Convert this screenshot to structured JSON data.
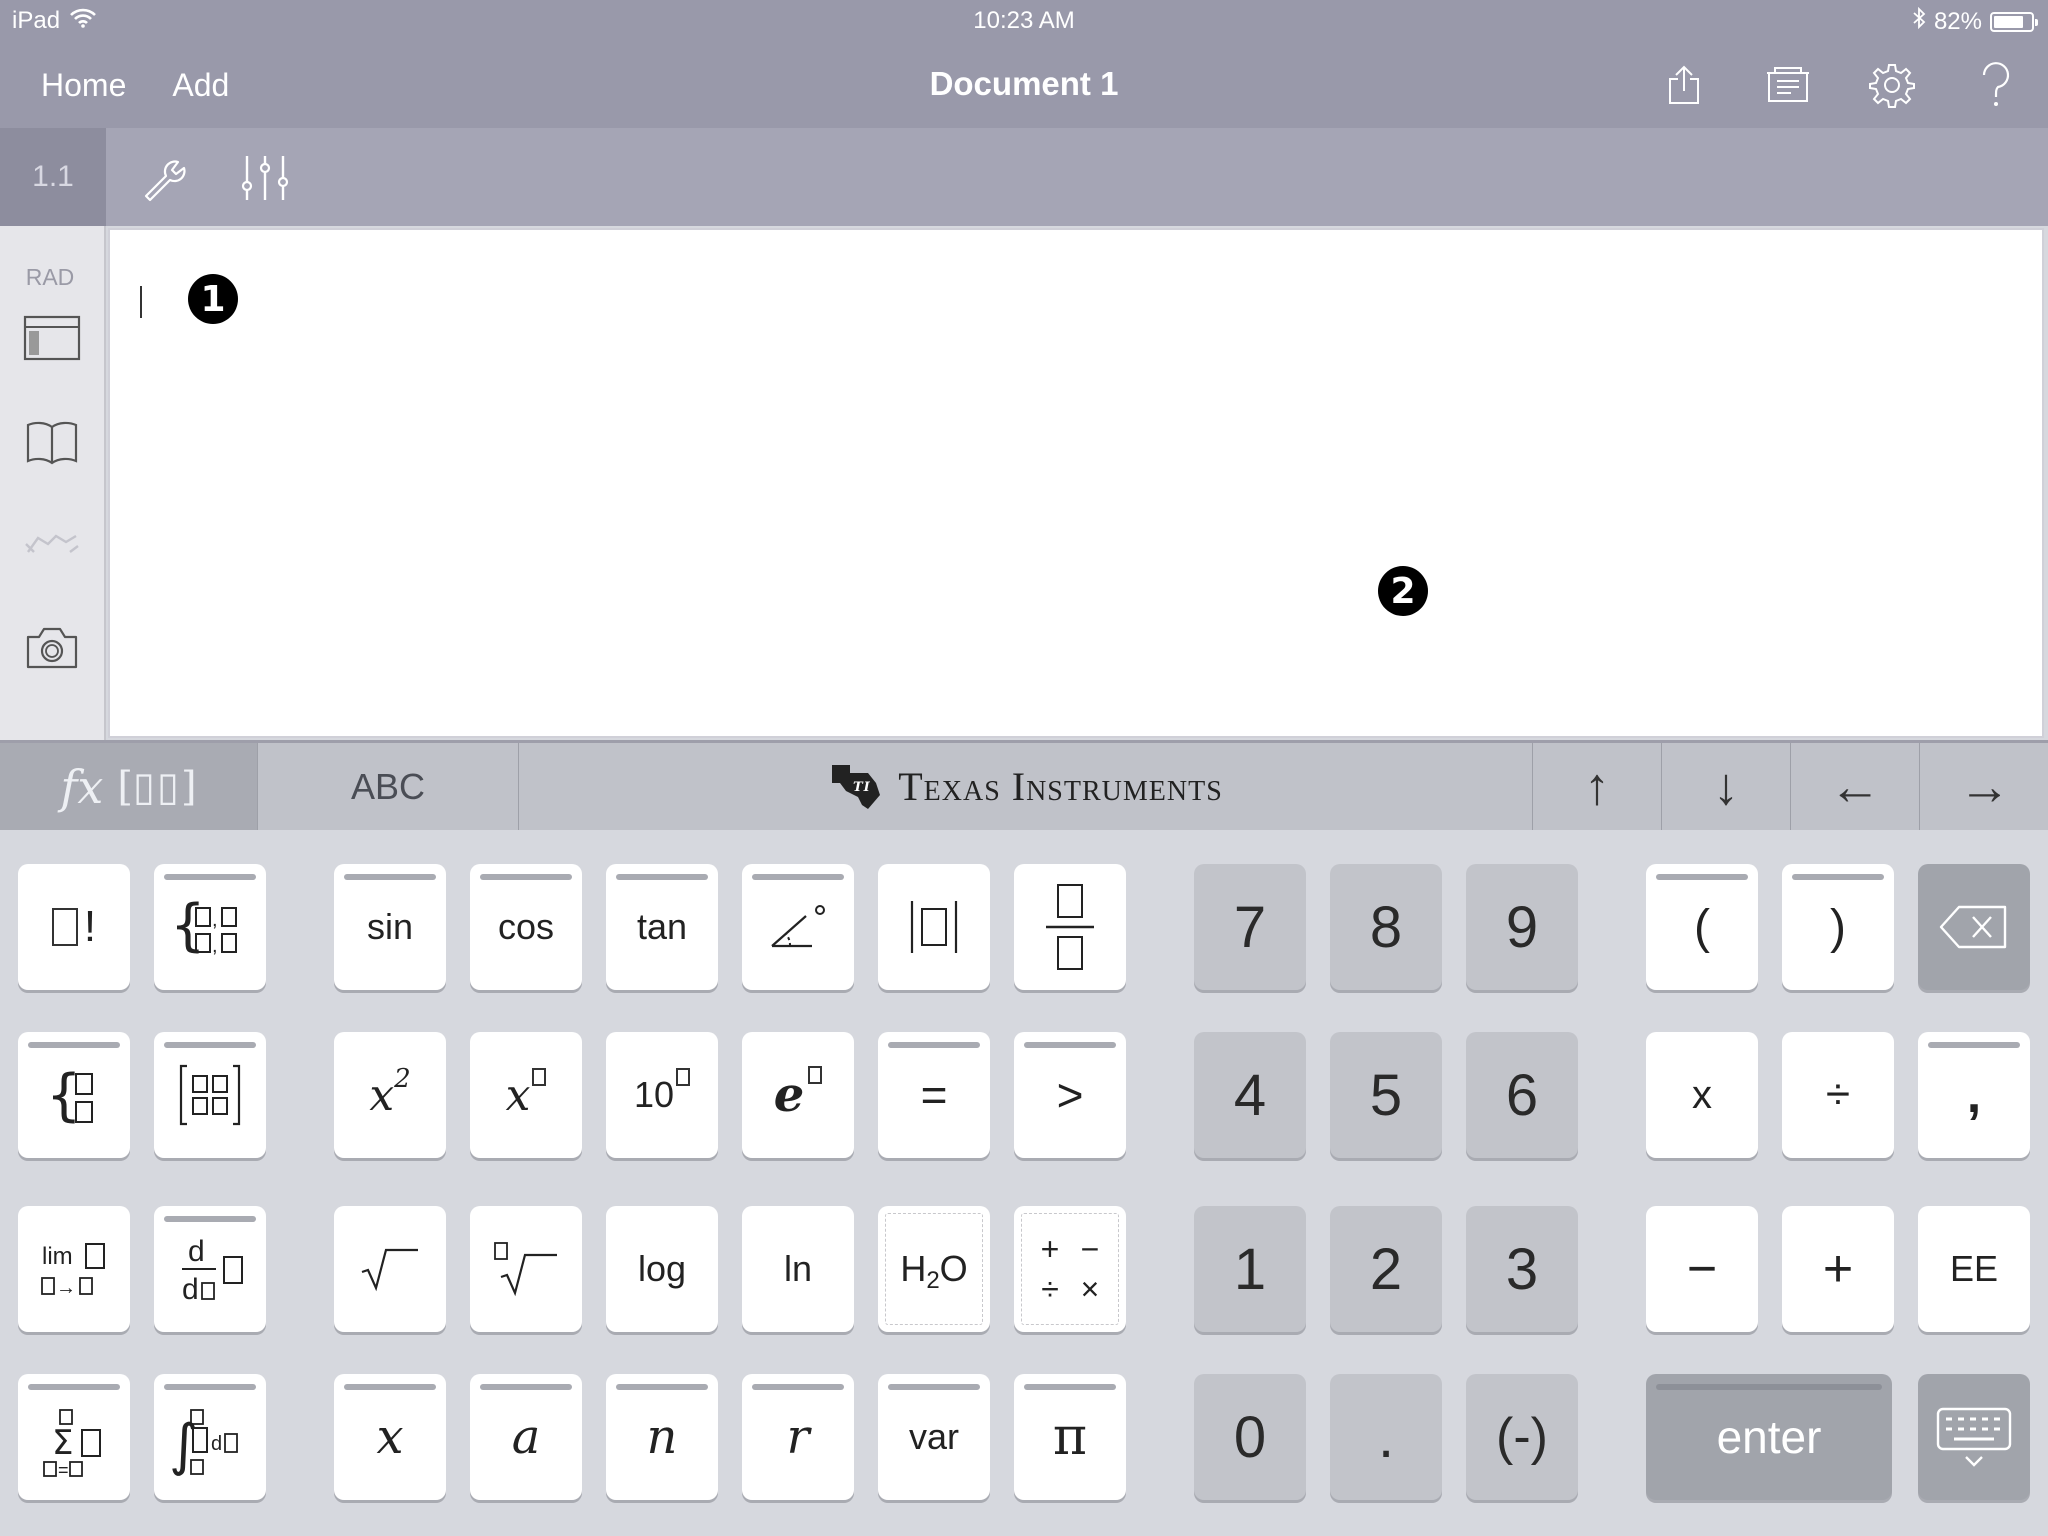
{
  "status": {
    "device": "iPad",
    "time": "10:23 AM",
    "battery": "82%",
    "battery_level": 0.82
  },
  "nav": {
    "home": "Home",
    "add": "Add",
    "title": "Document 1"
  },
  "toolbar": {
    "page": "1.1"
  },
  "sidebar": {
    "mode": "RAD"
  },
  "markers": {
    "one": "1",
    "two": "2"
  },
  "kbd_strip": {
    "fx": "fx",
    "abc": "ABC",
    "brand": "Texas Instruments",
    "up": "↑",
    "down": "↓",
    "left": "←",
    "right": "→"
  },
  "keys": {
    "sin": "sin",
    "cos": "cos",
    "tan": "tan",
    "n7": "7",
    "n8": "8",
    "n9": "9",
    "lparen": "(",
    "rparen": ")",
    "x2_base": "x",
    "x2_exp": "2",
    "xbox_base": "x",
    "ten": "10",
    "e": "e",
    "eq": "=",
    "gt": ">",
    "n4": "4",
    "n5": "5",
    "n6": "6",
    "times": "x",
    "divide": "÷",
    "comma": ",",
    "lim": "lim",
    "arrow": "→",
    "d": "d",
    "log": "log",
    "ln": "ln",
    "h2o_h": "H",
    "h2o_2": "2",
    "h2o_o": "O",
    "ops_plus": "+",
    "ops_minus": "−",
    "ops_div": "÷",
    "ops_times": "×",
    "n1": "1",
    "n2": "2",
    "n3": "3",
    "minus": "−",
    "plus": "+",
    "ee": "EE",
    "var_x": "x",
    "var_a": "a",
    "var_n": "n",
    "var_r": "r",
    "var": "var",
    "pi": "π",
    "n0": "0",
    "dot": ".",
    "neg": "(-)",
    "enter": "enter",
    "sigma": "Σ",
    "integral": "∫",
    "eq_small": "="
  }
}
